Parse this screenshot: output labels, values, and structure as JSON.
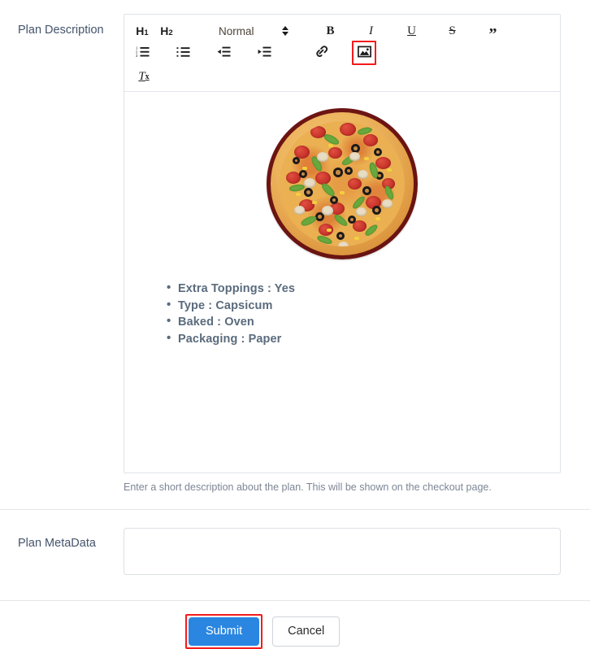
{
  "form": {
    "description_label": "Plan Description",
    "metadata_label": "Plan MetaData",
    "help_text": "Enter a short description about the plan. This will be shown on the checkout page.",
    "metadata_value": "",
    "metadata_placeholder": ""
  },
  "toolbar": {
    "h1_label": "H",
    "h1_sub": "1",
    "h2_label": "H",
    "h2_sub": "2",
    "size_picker_value": "Normal",
    "bold_label": "B",
    "italic_label": "I",
    "underline_label": "U",
    "strike_label": "S",
    "blockquote_label": "”",
    "clear_format_label": "T",
    "clear_format_sub": "x",
    "icons": {
      "ordered_list": "ordered-list-icon",
      "bullet_list": "bullet-list-icon",
      "outdent": "outdent-icon",
      "indent": "indent-icon",
      "link": "link-icon",
      "image": "image-icon",
      "picker_arrows": "chevron-updown-icon"
    },
    "highlight_color": "#f41b1b",
    "highlighted_item": "image-icon"
  },
  "editor_content": {
    "image_alt": "pizza-image",
    "bullets": [
      "Extra Toppings : Yes",
      "Type : Capsicum",
      "Baked : Oven",
      "Packaging : Paper"
    ]
  },
  "footer": {
    "submit_label": "Submit",
    "cancel_label": "Cancel",
    "submit_color": "#2a86e0",
    "submit_highlight": "#f41b1b"
  }
}
